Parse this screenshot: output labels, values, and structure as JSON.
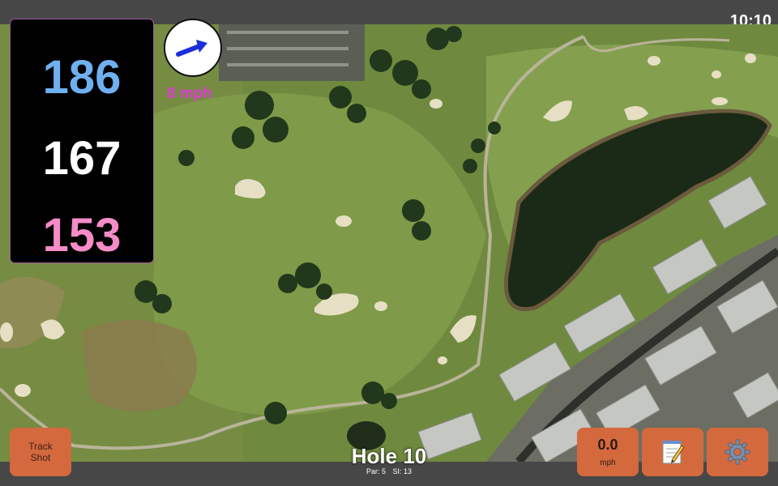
{
  "status": {
    "time": "10:10"
  },
  "distances": {
    "back": "186",
    "center": "167",
    "front": "153"
  },
  "wind": {
    "label": "8 mph",
    "icon": "wind-direction-arrow-icon"
  },
  "hole": {
    "title": "Hole 10",
    "par": "Par: 5",
    "stroke_index": "SI: 13"
  },
  "buttons": {
    "track_shot": "Track\nShot",
    "speed_value": "0.0",
    "speed_unit": "mph",
    "notes_icon": "notepad-icon",
    "settings_icon": "gear-icon"
  },
  "colors": {
    "back": "#6fb0f0",
    "center": "#ffffff",
    "front": "#f58cc8",
    "wind_label": "#e13bd6",
    "button_accent": "#d4693e",
    "bar": "#474747"
  }
}
